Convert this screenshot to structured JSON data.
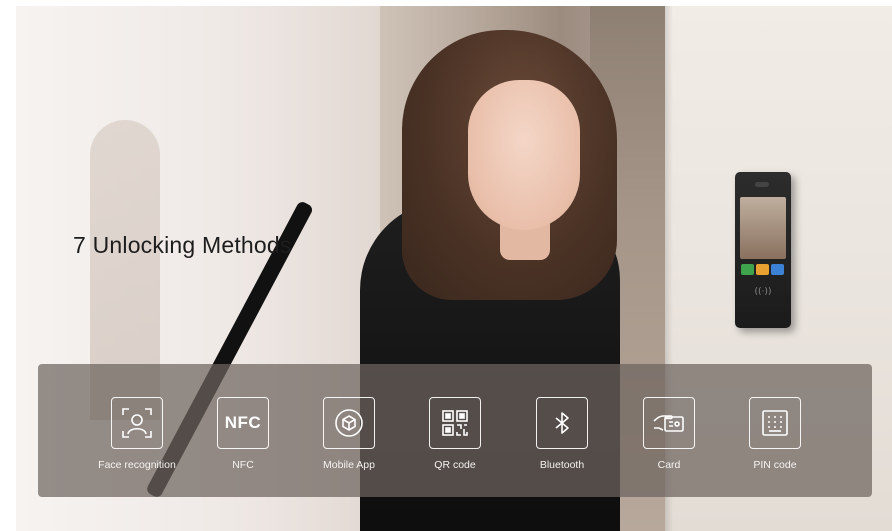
{
  "headline": "7 Unlocking Methods",
  "device": {
    "nfc_mark": "((·))"
  },
  "methods": [
    {
      "label": "Face recognition",
      "icon": "face-recognition-icon"
    },
    {
      "label": "NFC",
      "icon": "nfc-icon",
      "icon_text": "NFC"
    },
    {
      "label": "Mobile App",
      "icon": "mobile-app-icon"
    },
    {
      "label": "QR code",
      "icon": "qr-code-icon"
    },
    {
      "label": "Bluetooth",
      "icon": "bluetooth-icon"
    },
    {
      "label": "Card",
      "icon": "card-icon"
    },
    {
      "label": "PIN code",
      "icon": "pin-code-icon"
    }
  ],
  "colors": {
    "bar": "#6e645e",
    "icon_stroke": "#ffffff",
    "headline": "#1d1d1d"
  }
}
